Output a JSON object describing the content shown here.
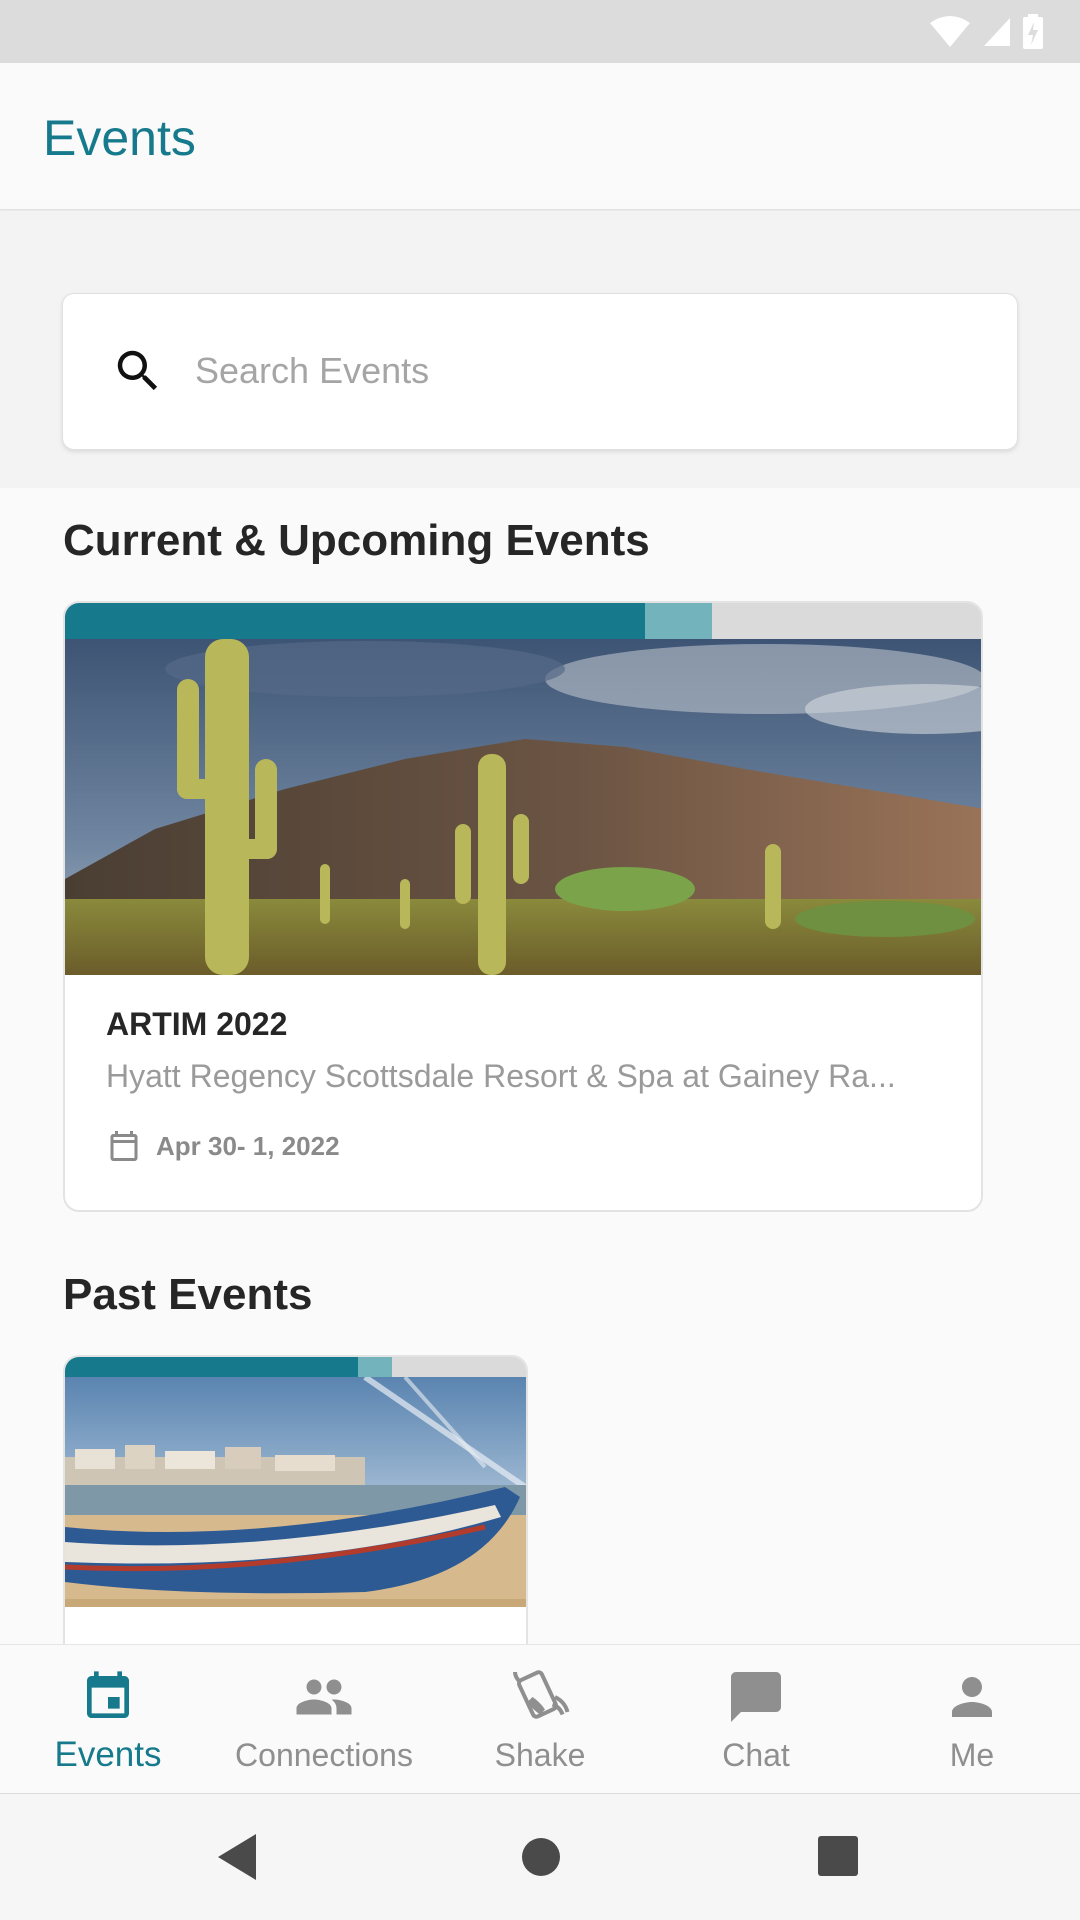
{
  "app": {
    "title": "Events"
  },
  "search": {
    "placeholder": "Search Events",
    "value": ""
  },
  "sections": {
    "current_title": "Current & Upcoming Events",
    "past_title": "Past Events"
  },
  "current_events": [
    {
      "title": "ARTIM 2022",
      "location": "Hyatt Regency Scottsdale Resort & Spa at Gainey Ra...",
      "date": "Apr 30- 1, 2022",
      "image_icon": "desert-cactus-image"
    }
  ],
  "past_events": [
    {
      "image_icon": "harbor-boat-image"
    }
  ],
  "bottom_nav": {
    "items": [
      {
        "label": "Events",
        "icon": "calendar-icon",
        "active": true
      },
      {
        "label": "Connections",
        "icon": "people-icon",
        "active": false
      },
      {
        "label": "Shake",
        "icon": "shake-phone-icon",
        "active": false
      },
      {
        "label": "Chat",
        "icon": "chat-bubble-icon",
        "active": false
      },
      {
        "label": "Me",
        "icon": "person-icon",
        "active": false
      }
    ]
  },
  "colors": {
    "accent": "#167a8c",
    "accent_light": "#72b3bc",
    "inactive": "#8f8f8f"
  }
}
